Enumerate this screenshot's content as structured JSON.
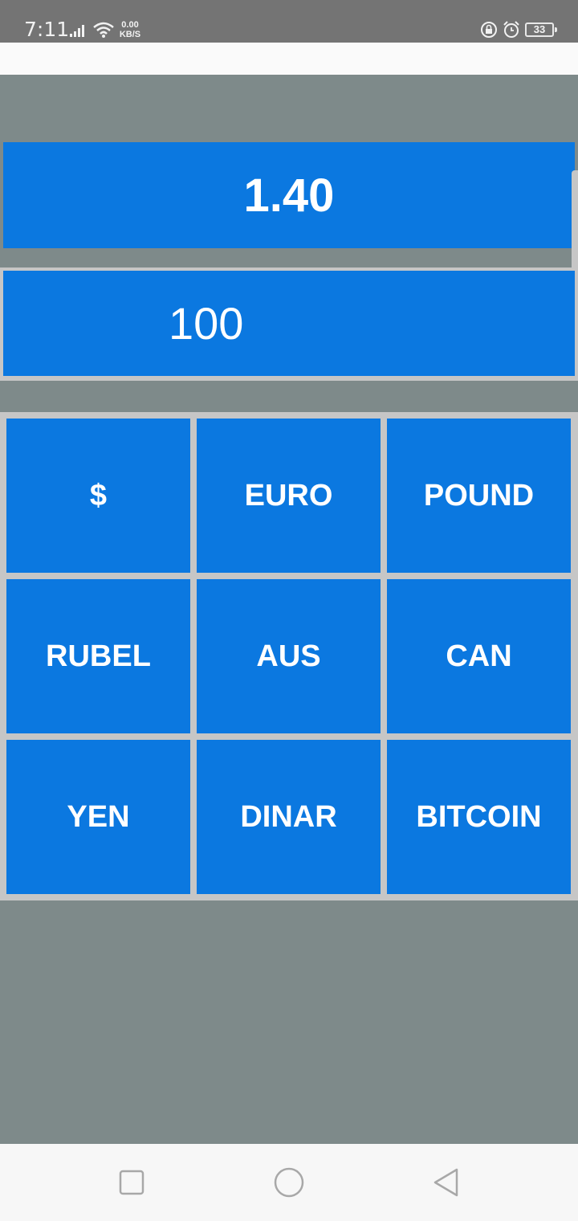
{
  "status_bar": {
    "time": "7:11",
    "net_speed_value": "0.00",
    "net_speed_unit": "KB/S",
    "battery_level": "33",
    "icons": [
      "signal-icon",
      "wifi-icon",
      "rotation-lock-icon",
      "alarm-icon",
      "battery-icon"
    ]
  },
  "display": {
    "result": "1.40",
    "input_value": "100"
  },
  "currencies": [
    {
      "label": "$"
    },
    {
      "label": "EURO"
    },
    {
      "label": "POUND"
    },
    {
      "label": "RUBEL"
    },
    {
      "label": "AUS"
    },
    {
      "label": "CAN"
    },
    {
      "label": "YEN"
    },
    {
      "label": "DINAR"
    },
    {
      "label": "BITCOIN"
    }
  ],
  "nav": {
    "icons": [
      "recent-apps-icon",
      "home-icon",
      "back-icon"
    ]
  },
  "colors": {
    "primary": "#0b78e0",
    "background": "#7e8a8a",
    "grid_border": "#c6c6c6"
  }
}
